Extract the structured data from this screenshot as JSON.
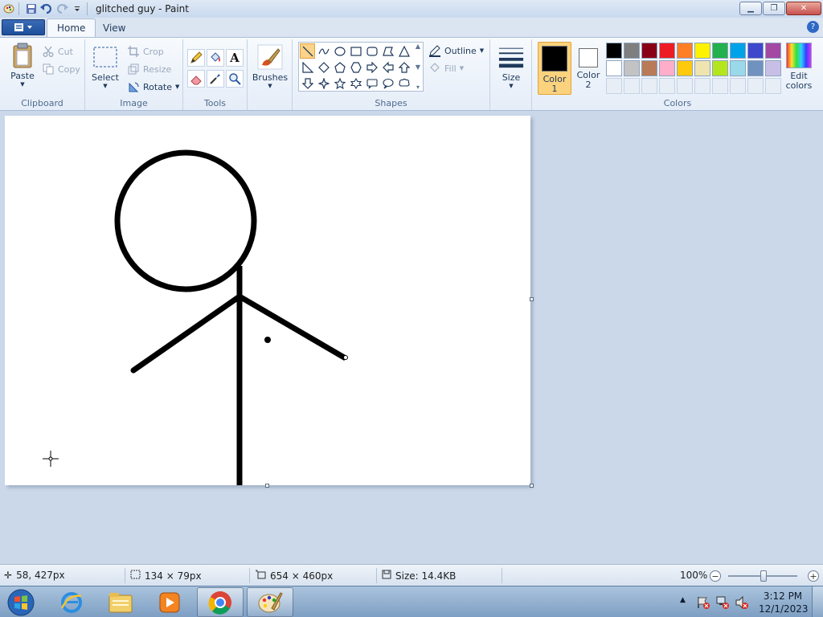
{
  "window": {
    "title": "glitched guy - Paint",
    "controls": [
      "minimize-icon",
      "restore-icon",
      "close-icon"
    ]
  },
  "quick_access": {
    "icons": [
      "paint-app-icon",
      "save-icon",
      "undo-icon",
      "redo-icon",
      "customize-dropdown-icon"
    ]
  },
  "tabs": [
    {
      "label": "Home",
      "active": true
    },
    {
      "label": "View",
      "active": false
    }
  ],
  "ribbon": {
    "clipboard": {
      "label": "Clipboard",
      "paste": "Paste",
      "cut": "Cut",
      "copy": "Copy"
    },
    "image": {
      "label": "Image",
      "select": "Select",
      "crop": "Crop",
      "resize": "Resize",
      "rotate": "Rotate"
    },
    "tools": {
      "label": "Tools",
      "items": [
        "pencil-icon",
        "fill-bucket-icon",
        "text-icon",
        "eraser-icon",
        "color-picker-icon",
        "magnifier-icon"
      ]
    },
    "brushes": {
      "label": "Brushes"
    },
    "shapes": {
      "label": "Shapes",
      "outline": "Outline",
      "fill": "Fill",
      "selected": "line"
    },
    "size": {
      "label": "Size"
    },
    "colors": {
      "label": "Colors",
      "color1_line1": "Color",
      "color1_line2": "1",
      "color2_line1": "Color",
      "color2_line2": "2",
      "edit_line1": "Edit",
      "edit_line2": "colors",
      "color1": "#000000",
      "color2": "#ffffff",
      "palette_row1": [
        "#000000",
        "#7f7f7f",
        "#880015",
        "#ed1c24",
        "#ff7f27",
        "#fff200",
        "#22b14c",
        "#00a2e8",
        "#3f48cc",
        "#a349a4"
      ],
      "palette_row2": [
        "#ffffff",
        "#c3c3c3",
        "#b97a57",
        "#ffaec9",
        "#ffc90e",
        "#efe4b0",
        "#b5e61d",
        "#99d9ea",
        "#7092be",
        "#c8bfe7"
      ]
    }
  },
  "status": {
    "cursor_pos": "58, 427px",
    "selection_size": "134 × 79px",
    "canvas_size": "654 × 460px",
    "file_size": "Size: 14.4KB",
    "zoom": "100%"
  },
  "taskbar": {
    "apps": [
      "internet-explorer-icon",
      "file-explorer-icon",
      "media-player-icon",
      "chrome-icon",
      "paint-icon"
    ],
    "time": "3:12 PM",
    "date": "12/1/2023"
  }
}
